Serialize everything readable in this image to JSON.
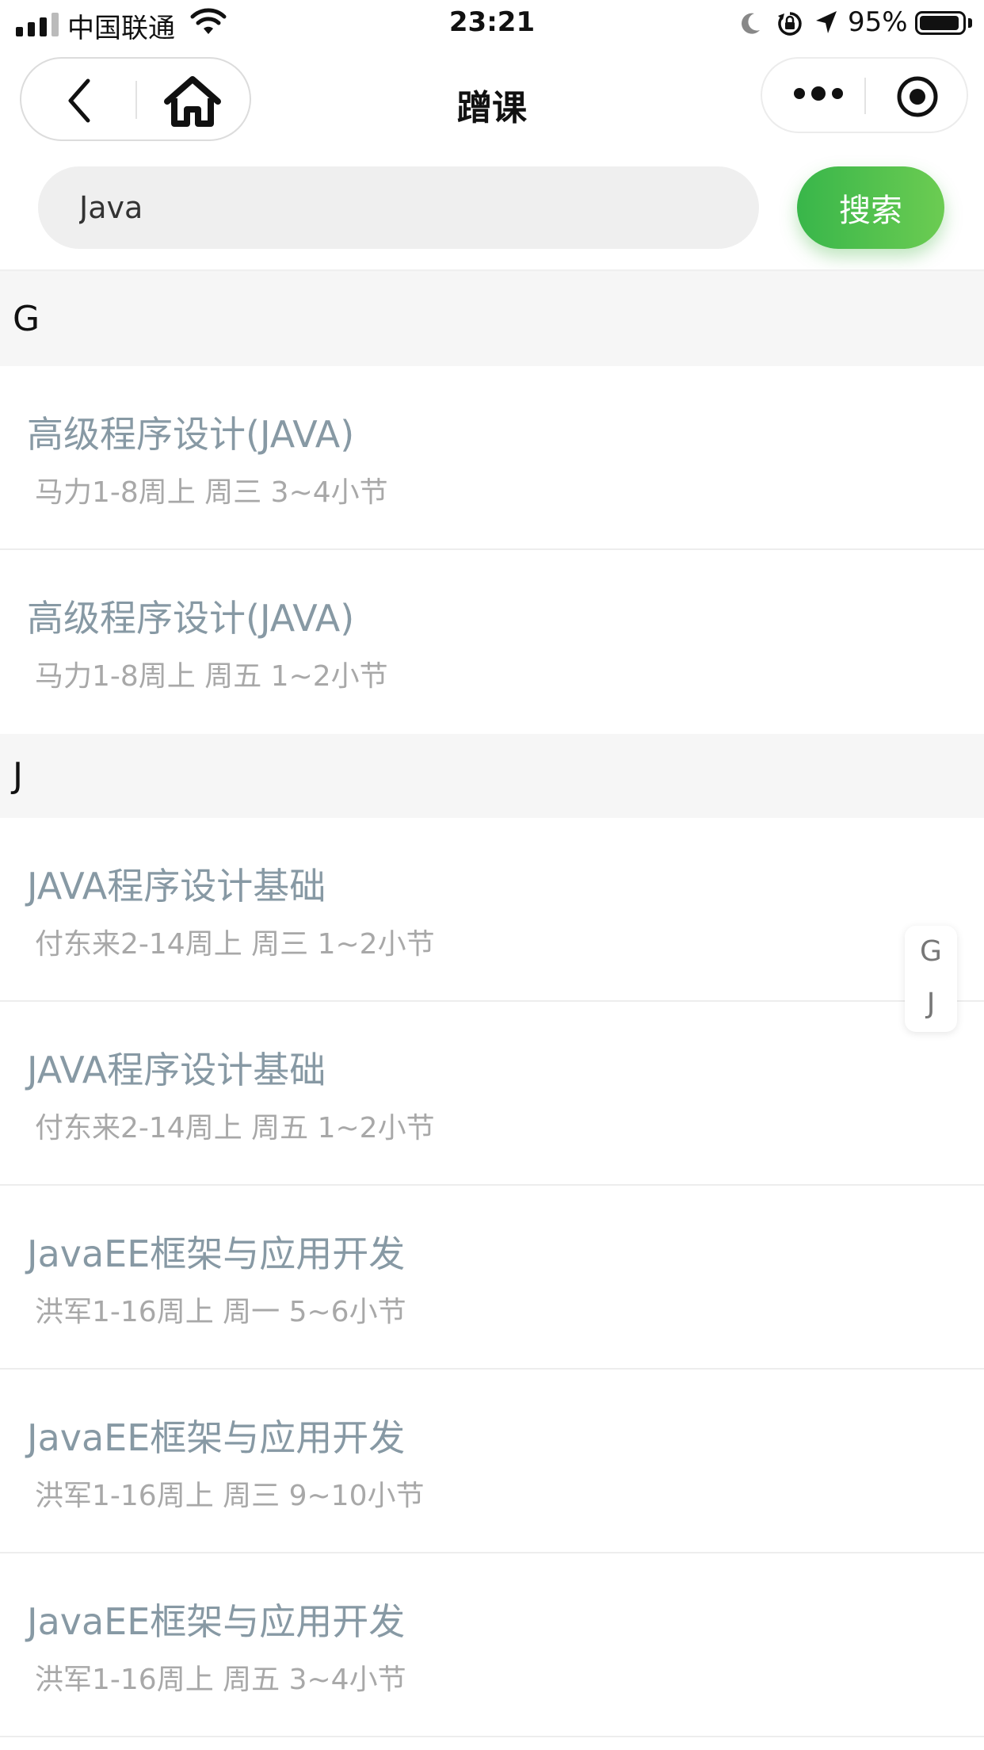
{
  "status_bar": {
    "carrier": "中国联通",
    "time": "23:21",
    "battery_percent": "95%",
    "battery_level": 0.95
  },
  "nav": {
    "title": "蹭课"
  },
  "search": {
    "value": "Java",
    "button_label": "搜索"
  },
  "sections": [
    {
      "letter": "G",
      "courses": [
        {
          "name": "高级程序设计(JAVA)",
          "detail": "马力1-8周上 周三 3~4小节"
        },
        {
          "name": "高级程序设计(JAVA)",
          "detail": "马力1-8周上 周五 1~2小节"
        }
      ]
    },
    {
      "letter": "J",
      "courses": [
        {
          "name": "JAVA程序设计基础",
          "detail": "付东来2-14周上 周三 1~2小节"
        },
        {
          "name": "JAVA程序设计基础",
          "detail": "付东来2-14周上 周五 1~2小节"
        },
        {
          "name": "JavaEE框架与应用开发",
          "detail": "洪军1-16周上 周一 5~6小节"
        },
        {
          "name": "JavaEE框架与应用开发",
          "detail": "洪军1-16周上 周三 9~10小节"
        },
        {
          "name": "JavaEE框架与应用开发",
          "detail": "洪军1-16周上 周五 3~4小节"
        }
      ]
    }
  ],
  "index_bar": [
    "G",
    "J"
  ]
}
